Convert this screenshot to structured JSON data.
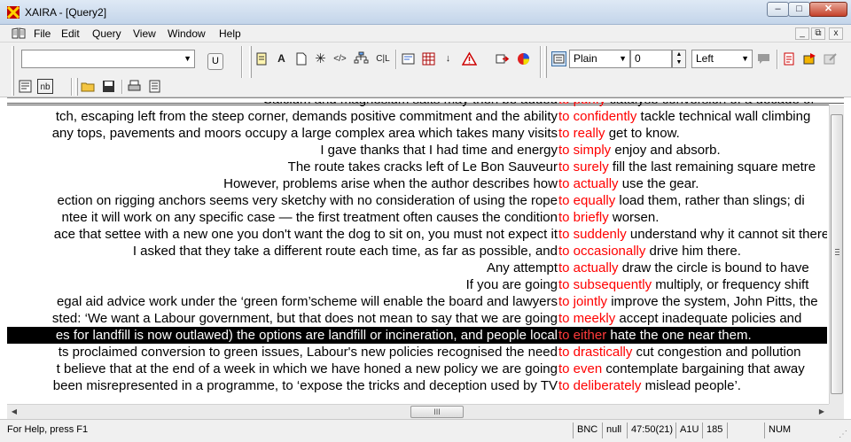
{
  "window": {
    "title": "XAIRA - [Query2]",
    "buttons": {
      "minimize": "–",
      "maximize": "□",
      "close": "✕"
    }
  },
  "menu": {
    "items": [
      "File",
      "Edit",
      "Query",
      "View",
      "Window",
      "Help"
    ],
    "mdi_buttons": {
      "minimize": "_",
      "restore": "⧉",
      "close": "x"
    }
  },
  "toolbar": {
    "search_value": "",
    "u_button": "U",
    "style_select": "Plain",
    "number_value": "0",
    "align_select": "Left",
    "icons": [
      "label-icon",
      "font-icon",
      "document-icon",
      "wildcard-icon",
      "tag-icon",
      "tree-icon",
      "cl-icon",
      "edit-query-icon",
      "grid-icon",
      "sort-icon",
      "warning-icon",
      "export-icon",
      "colour-wheel-icon",
      "text-style-icon",
      "comment-icon",
      "sort-lines-icon",
      "flag-icon",
      "disabled-edit-icon",
      "text-view-icon",
      "nb-icon",
      "open-folder-icon",
      "save-icon",
      "print-icon",
      "page-icon"
    ],
    "icon_labels": {
      "font": "A",
      "cl": "C|L",
      "nb": "nb"
    }
  },
  "concordance": {
    "rows": [
      {
        "left": "Calcium and magnesium salts may then be added",
        "node": "to purify",
        "right": " catalyse conversion of a decade of"
      },
      {
        "left": "tch, escaping left from the steep corner, demands positive commitment and the ability",
        "node": "to confidently",
        "right": " tackle technical wall climbing"
      },
      {
        "left": "any tops, pavements and moors occupy a large complex area which takes many visits",
        "node": "to really",
        "right": " get to know."
      },
      {
        "left": "I gave thanks that I had time and energy",
        "node": "to simply",
        "right": " enjoy and absorb."
      },
      {
        "left": "The route takes cracks left of Le Bon Sauveur",
        "node": "to surely",
        "right": " fill the last remaining square metre"
      },
      {
        "left": "However, problems arise when the author describes how",
        "node": "to actually",
        "right": " use the gear."
      },
      {
        "left": "ection on rigging anchors seems very sketchy with no consideration of using the rope",
        "node": "to equally",
        "right": " load them, rather than slings; di"
      },
      {
        "left": "ntee it will work on any specific case — the first treatment often causes the condition",
        "node": "to briefly",
        "right": " worsen."
      },
      {
        "left": "ace that settee with a new one you don't want the dog to sit on, you must not expect it",
        "node": "to suddenly",
        "right": " understand why it cannot sit there"
      },
      {
        "left": "I asked that they take a different route each time, as far as possible, and",
        "node": "to occasionally",
        "right": " drive him there."
      },
      {
        "left": "Any attempt",
        "node": "to actually",
        "right": " draw the circle is bound to have"
      },
      {
        "left": "If you are going",
        "node": "to subsequently",
        "right": " multiply, or frequency shift"
      },
      {
        "left": "egal aid advice work under the ‘green form’scheme will enable the board and lawyers",
        "node": "to jointly",
        "right": " improve the system, John Pitts, the"
      },
      {
        "left": "sted: ‘We want a Labour government, but that does not mean to say that we are going",
        "node": "to meekly",
        "right": " accept inadequate policies and"
      },
      {
        "left": "es for landfill is now outlawed) the options are landfill or incineration, and people local",
        "node": "to either",
        "right": " hate the one near them."
      },
      {
        "left": "ts proclaimed conversion to green issues, Labour's new policies recognised the need",
        "node": "to drastically",
        "right": " cut congestion and pollution"
      },
      {
        "left": "t believe that at the end of a week in which we have honed a new policy we are going",
        "node": "to even",
        "right": " contemplate bargaining that away"
      },
      {
        "left": "been misrepresented in a programme, to ‘expose the tricks and deception used by TV",
        "node": "to deliberately",
        "right": " mislead people’."
      }
    ],
    "selected_row": 14,
    "hscroll_thumb": "III"
  },
  "status": {
    "message": "For Help, press F1",
    "cells": [
      "BNC",
      "null",
      "47:50(21)",
      "A1U",
      "185",
      "",
      "NUM"
    ]
  },
  "colors": {
    "node": "#ff0000",
    "selection": "#000000",
    "chrome": "#f0f0f0"
  }
}
